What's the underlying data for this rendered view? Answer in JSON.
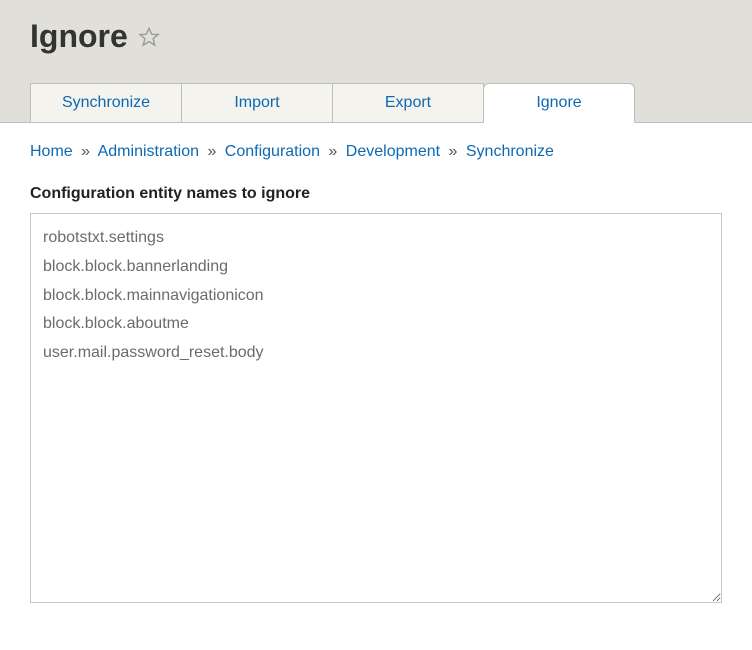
{
  "page": {
    "title": "Ignore"
  },
  "tabs": [
    {
      "label": "Synchronize",
      "active": false
    },
    {
      "label": "Import",
      "active": false
    },
    {
      "label": "Export",
      "active": false
    },
    {
      "label": "Ignore",
      "active": true
    }
  ],
  "breadcrumb": {
    "items": [
      "Home",
      "Administration",
      "Configuration",
      "Development",
      "Synchronize"
    ],
    "separator": "»"
  },
  "form": {
    "label": "Configuration entity names to ignore",
    "textarea_value": "robotstxt.settings\nblock.block.bannerlanding\nblock.block.mainnavigationicon\nblock.block.aboutme\nuser.mail.password_reset.body"
  }
}
